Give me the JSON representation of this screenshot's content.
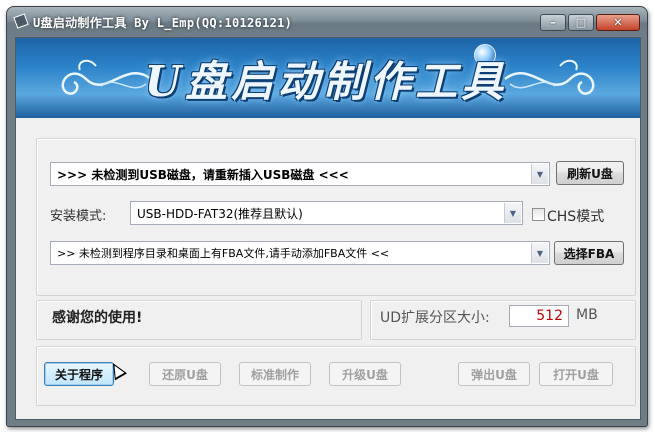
{
  "window": {
    "title": "U盘启动制作工具 By L_Emp(QQ:10126121)",
    "min_glyph": "–",
    "max_glyph": "□",
    "close_glyph": "✕"
  },
  "banner": {
    "title": "U盘启动制作工具"
  },
  "device": {
    "selected": ">>> 未检测到USB磁盘，请重新插入USB磁盘 <<<",
    "refresh_label": "刷新U盘"
  },
  "install_mode": {
    "label": "安装模式:",
    "selected": "USB-HDD-FAT32(推荐且默认)",
    "chs_label": "CHS模式",
    "chs_checked": false
  },
  "fba": {
    "selected": ">> 未检测到程序目录和桌面上有FBA文件,请手动添加FBA文件 <<",
    "select_label": "选择FBA"
  },
  "status": {
    "message": "感谢您的使用!"
  },
  "partition": {
    "label": "UD扩展分区大小:",
    "value": "512",
    "unit": "MB"
  },
  "actions": {
    "about": "关于程序",
    "restore": "还原U盘",
    "standard": "标准制作",
    "upgrade": "升级U盘",
    "eject": "弹出U盘",
    "open": "打开U盘"
  },
  "colors": {
    "banner": "#2b82c8",
    "partition_value": "#c00000"
  },
  "icons": {
    "dropdown": "chevron-down-icon",
    "app": "usb-drive-icon"
  }
}
